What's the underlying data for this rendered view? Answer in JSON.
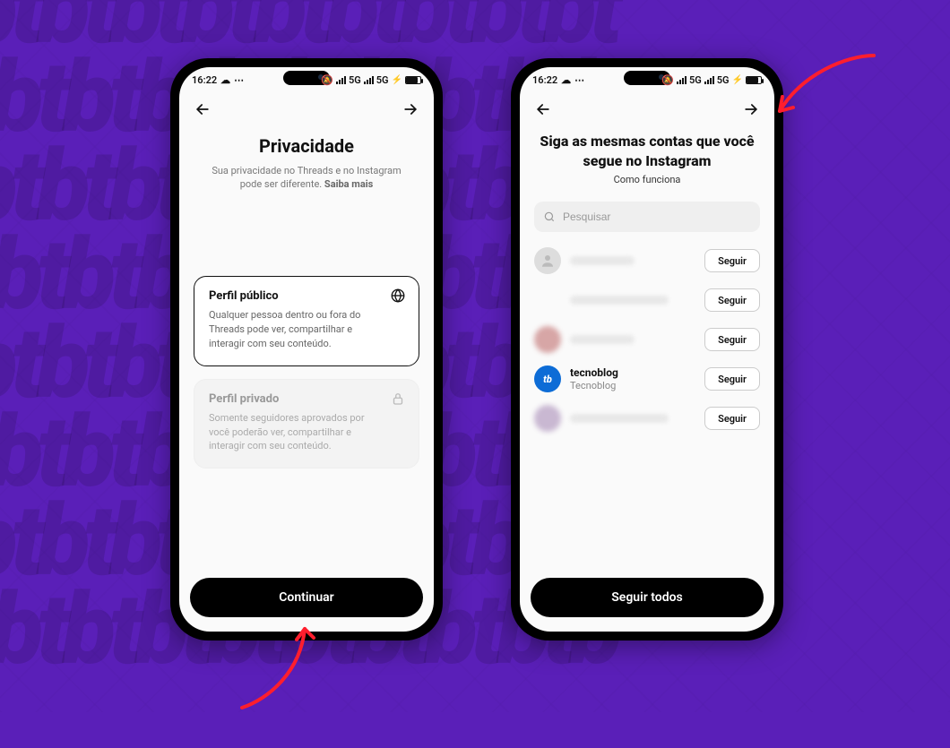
{
  "statusbar": {
    "time": "16:22",
    "net_label": "5G",
    "net_label2": "5G"
  },
  "privacy_screen": {
    "title": "Privacidade",
    "subtitle_pre": "Sua privacidade no Threads e no Instagram pode ser diferente.",
    "subtitle_link": "Saiba mais",
    "option_public": {
      "title": "Perfil público",
      "desc": "Qualquer pessoa dentro ou fora do Threads pode ver, compartilhar e interagir com seu conteúdo."
    },
    "option_private": {
      "title": "Perfil privado",
      "desc": "Somente seguidores aprovados por você poderão ver, compartilhar e interagir com seu conteúdo."
    },
    "continue_label": "Continuar"
  },
  "follow_screen": {
    "title": "Siga as mesmas contas que você segue no Instagram",
    "how_it_works": "Como funciona",
    "search_placeholder": "Pesquisar",
    "follow_label": "Seguir",
    "follow_all_label": "Seguir todos",
    "rows": [
      {
        "type": "blurred"
      },
      {
        "type": "blurred_noav"
      },
      {
        "type": "blurred_av"
      },
      {
        "type": "named",
        "username": "tecnoblog",
        "display": "Tecnoblog"
      },
      {
        "type": "blurred_av"
      }
    ]
  }
}
